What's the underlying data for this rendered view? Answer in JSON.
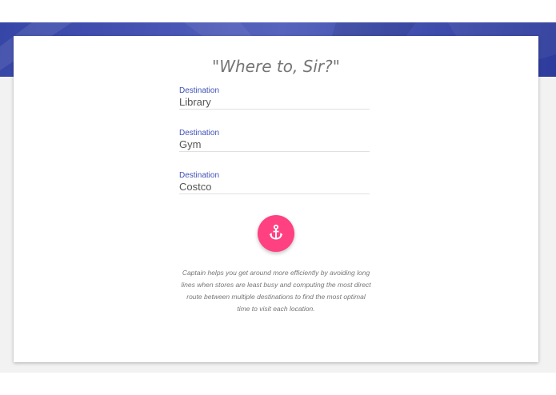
{
  "banner": {
    "color": "#3f51b5"
  },
  "card": {
    "title": "\"Where to, Sir?\"",
    "fields": [
      {
        "label": "Destination",
        "value": "Library"
      },
      {
        "label": "Destination",
        "value": "Gym"
      },
      {
        "label": "Destination",
        "value": "Costco"
      }
    ],
    "fab": {
      "icon": "anchor-icon",
      "color": "#ff4081"
    },
    "description_lines": [
      "Captain helps you get around more efficiently by avoiding long",
      "lines when stores are least busy and computing the most direct",
      "route between multiple destinations to find the most optimal",
      "time to visit each location."
    ]
  }
}
